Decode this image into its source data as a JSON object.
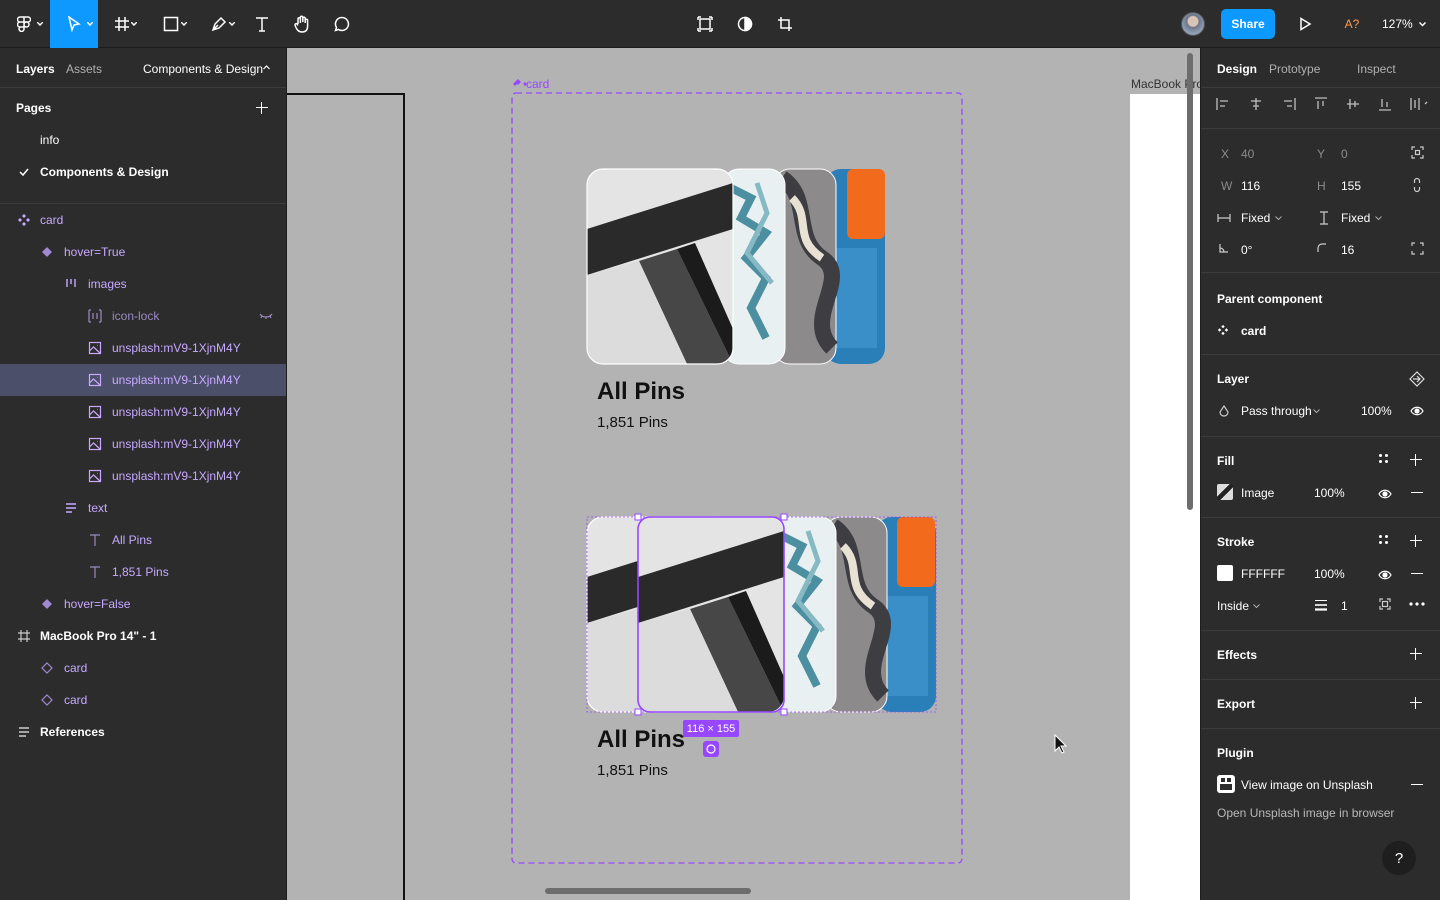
{
  "toolbar": {
    "share_label": "Share",
    "zoom": "127%",
    "avatar_initials": "A?"
  },
  "left": {
    "tabs": {
      "layers": "Layers",
      "assets": "Assets",
      "page": "Components & Design"
    },
    "pages_title": "Pages",
    "pages": [
      "info",
      "Components & Design"
    ],
    "layers": {
      "card": "card",
      "hover_true": "hover=True",
      "images": "images",
      "icon_lock": "icon-lock",
      "img1": "unsplash:mV9-1XjnM4Y",
      "img2": "unsplash:mV9-1XjnM4Y",
      "img3": "unsplash:mV9-1XjnM4Y",
      "img4": "unsplash:mV9-1XjnM4Y",
      "img5": "unsplash:mV9-1XjnM4Y",
      "text": "text",
      "all_pins": "All Pins",
      "pins_count": "1,851 Pins",
      "hover_false": "hover=False",
      "macbook": "MacBook Pro 14\" - 1",
      "card_a": "card",
      "card_b": "card",
      "references": "References"
    }
  },
  "canvas": {
    "component_label": "card",
    "frame_label": "MacBook Pro",
    "card_title": "All Pins",
    "card_count": "1,851 Pins",
    "selection_size": "116 × 155"
  },
  "right": {
    "tabs": {
      "design": "Design",
      "prototype": "Prototype",
      "inspect": "Inspect"
    },
    "x_label": "X",
    "x_value": "40",
    "y_label": "Y",
    "y_value": "0",
    "w_label": "W",
    "w_value": "116",
    "h_label": "H",
    "h_value": "155",
    "w_mode": "Fixed",
    "h_mode": "Fixed",
    "rotation": "0°",
    "radius": "16",
    "parent_title": "Parent component",
    "parent_name": "card",
    "layer_title": "Layer",
    "blend": "Pass through",
    "layer_opacity": "100%",
    "fill_title": "Fill",
    "fill_type": "Image",
    "fill_opacity": "100%",
    "stroke_title": "Stroke",
    "stroke_color": "FFFFFF",
    "stroke_opacity": "100%",
    "stroke_align": "Inside",
    "stroke_weight": "1",
    "effects_title": "Effects",
    "export_title": "Export",
    "plugin_title": "Plugin",
    "plugin_name": "View image on Unsplash",
    "plugin_desc": "Open Unsplash image in browser",
    "help": "?"
  },
  "colors": {
    "accent": "#0d99ff",
    "component": "#9747ff",
    "panel": "#2c2c2c",
    "canvas": "#b3b3b3"
  }
}
